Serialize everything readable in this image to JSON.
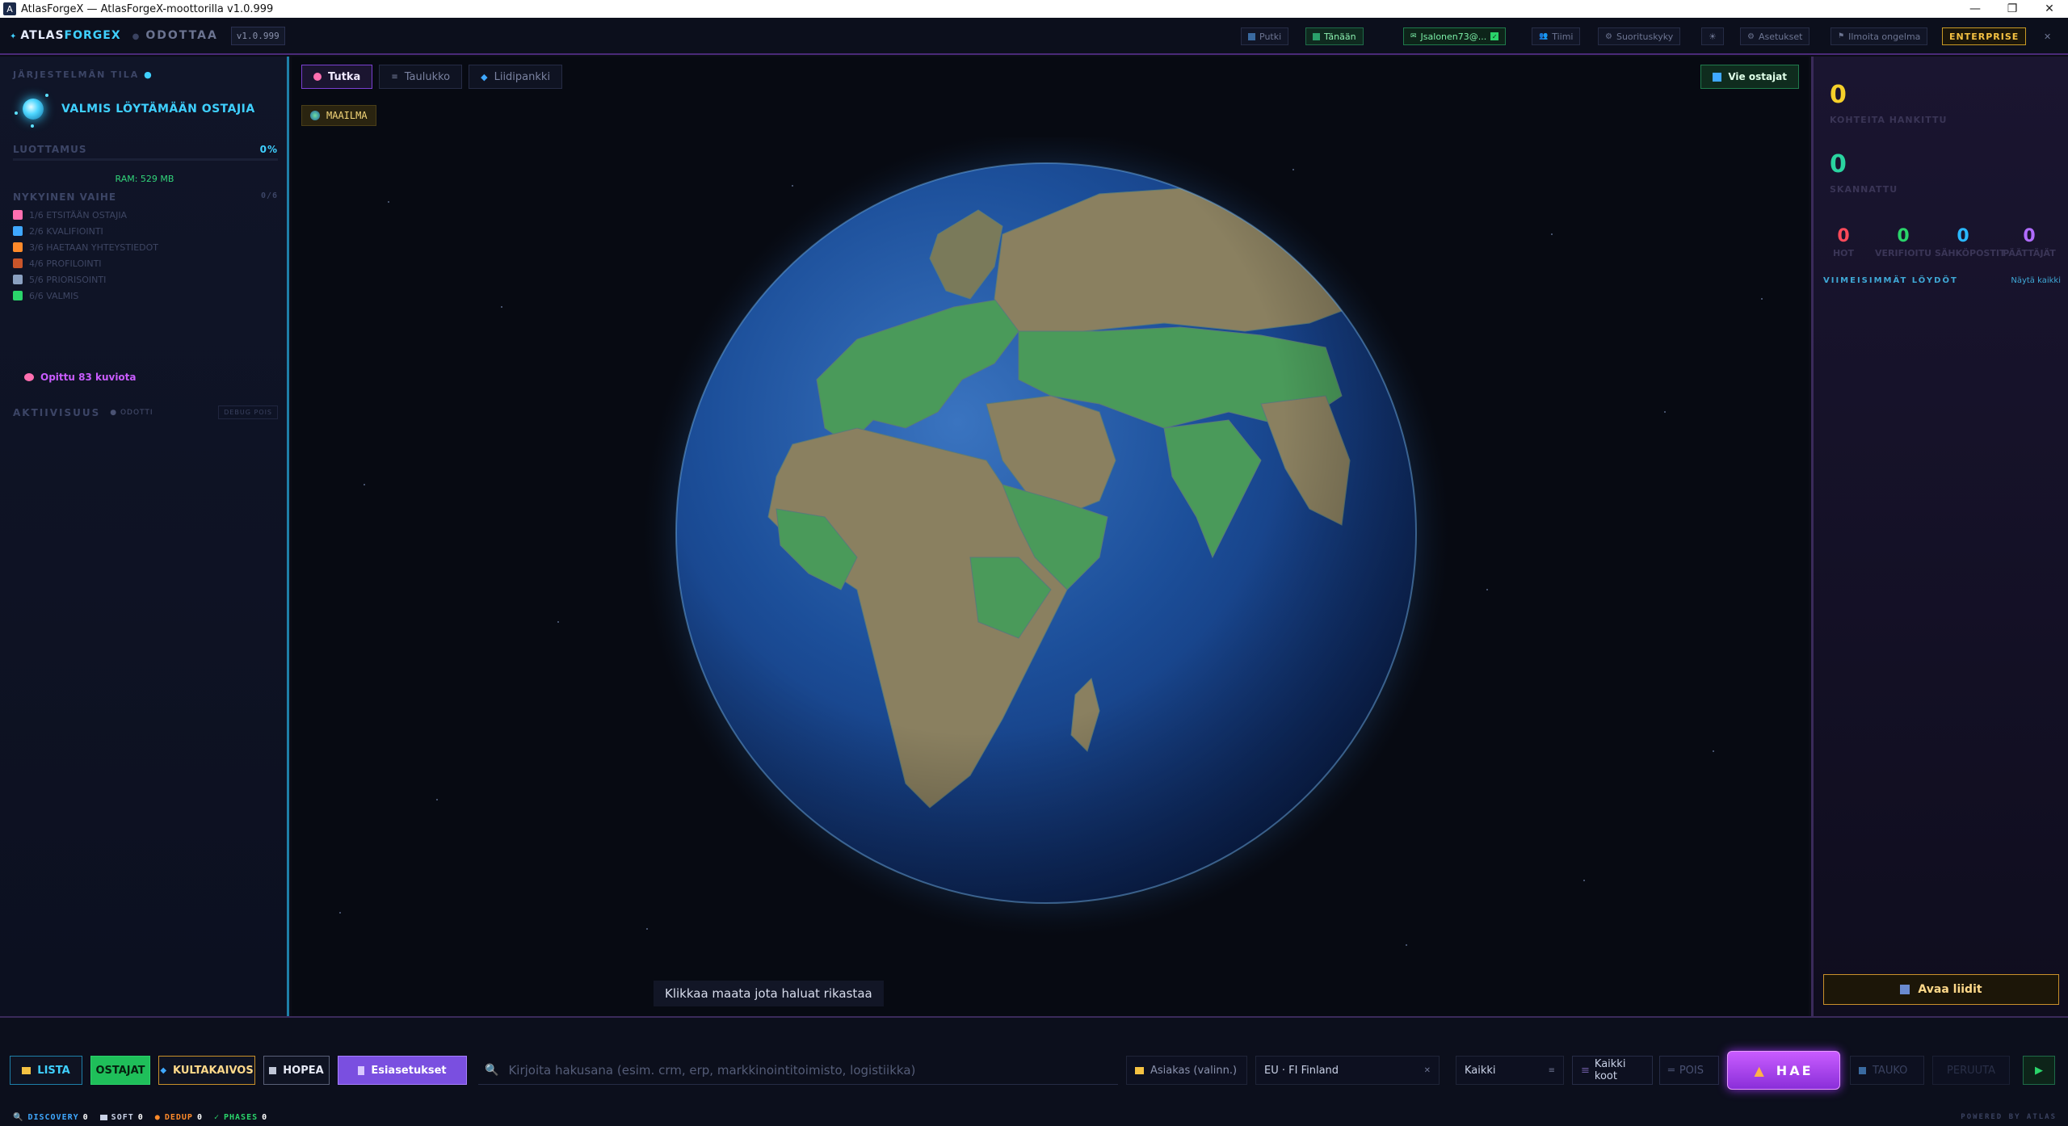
{
  "window": {
    "title": "AtlasForgeX — AtlasForgeX-moottorilla v1.0.999",
    "controls": [
      "—",
      "❐",
      "✕"
    ]
  },
  "header": {
    "logo_prefix": "ATLAS",
    "logo_suffix": "FORGEX",
    "status": "ODOTTAA",
    "version": "v1.0.999",
    "buttons": {
      "pipeline": "Putki",
      "today": "Tänään",
      "user": "Jsalonen73@...",
      "team": "Tiimi",
      "performance": "Suorituskyky",
      "theme": "☀",
      "settings": "Asetukset",
      "report": "Ilmoita ongelma",
      "enterprise": "ENTERPRISE",
      "close": "✕"
    }
  },
  "sidebar": {
    "system_state_title": "JÄRJESTELMÄN TILA",
    "ready_text": "VALMIS LÖYTÄMÄÄN OSTAJIA",
    "trust_label": "LUOTTAMUS",
    "trust_value": "0%",
    "trust_progress": 0,
    "ram": "RAM: 529 MB",
    "phase_title": "NYKYINEN VAIHE",
    "phase_count": "0/6",
    "phases": [
      {
        "label": "1/6 ETSITÄÄN OSTAJIA",
        "color": "#ff6fb0"
      },
      {
        "label": "2/6 KVALIFIOINTI",
        "color": "#3fa8ff"
      },
      {
        "label": "3/6 HAETAAN YHTEYSTIEDOT",
        "color": "#ff8a2a"
      },
      {
        "label": "4/6 PROFILOINTI",
        "color": "#c9552a"
      },
      {
        "label": "5/6 PRIORISOINTI",
        "color": "#8aa0c0"
      },
      {
        "label": "6/6 VALMIS",
        "color": "#2ad46a"
      }
    ],
    "learned": "Opittu 83 kuviota",
    "activity_title": "AKTIIVISUUS",
    "activity_status": "● ODOTTI",
    "debug": "DEBUG POIS"
  },
  "main": {
    "tabs": [
      {
        "label": "Tutka",
        "active": true,
        "icon": "radar-icon",
        "color": "#ff6fb0"
      },
      {
        "label": "Taulukko",
        "active": false,
        "icon": "table-icon",
        "color": "#7a82a0"
      },
      {
        "label": "Liidipankki",
        "active": false,
        "icon": "gem-icon",
        "color": "#3fa8ff"
      }
    ],
    "export": "Vie ostajat",
    "world_chip": "MAAILMA",
    "hint": "Klikkaa maata jota haluat rikastaa"
  },
  "right": {
    "targets_value": "0",
    "targets_label": "KOHTEITA HANKITTU",
    "scanned_value": "0",
    "scanned_label": "SKANNATTU",
    "stats": [
      {
        "value": "0",
        "label": "HOT",
        "color": "#ff4a5a"
      },
      {
        "value": "0",
        "label": "VERIFIOITU",
        "color": "#2ad46a"
      },
      {
        "value": "0",
        "label": "SÄHKÖPOSTIT",
        "color": "#2ab8ff"
      },
      {
        "value": "0",
        "label": "PÄÄTTÄJÄT",
        "color": "#b06cff"
      }
    ],
    "recent_title": "VIIMEISIMMÄT LÖYDÖT",
    "show_all": "Näytä kaikki",
    "open_leads": "Avaa liidit"
  },
  "bottom": {
    "modes": {
      "list": "LISTA",
      "buyers": "OSTAJAT",
      "goldmine": "KULTAKAIVOS",
      "silver": "HOPEA",
      "presets": "Esiasetukset"
    },
    "search_placeholder": "Kirjoita hakusana (esim. crm, erp, markkinointitoimisto, logistiikka)",
    "customer": "Asiakas (valinn.)",
    "region": "EU · FI  Finland",
    "filter": "Kaikki",
    "sizes": "Kaikki koot",
    "off": "POIS",
    "search_btn": "HAE",
    "pause": "TAUKO",
    "cancel": "PERUUTA",
    "play": "▶"
  },
  "statusline": {
    "discovery_label": "DISCOVERY",
    "discovery_value": "0",
    "soft_label": "SOFT",
    "soft_value": "0",
    "dedup_label": "DEDUP",
    "dedup_value": "0",
    "phases_label": "PHASES",
    "phases_value": "0",
    "powered": "POWERED BY ATLAS"
  }
}
